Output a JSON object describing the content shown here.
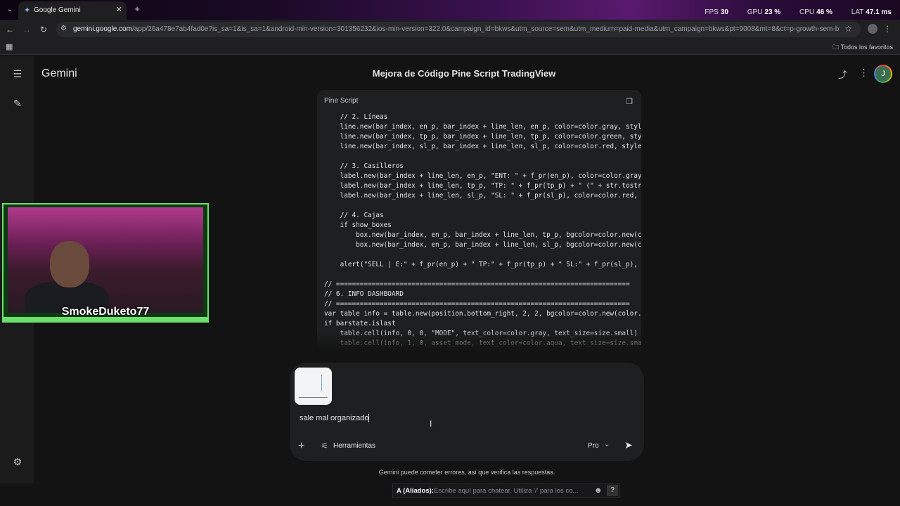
{
  "browser": {
    "tab_title": "Google Gemini",
    "tab_close": "✕",
    "new_tab": "+",
    "url_host": "gemini.google.com",
    "url_path": "/app/26a478e7ab4fad0e?is_sa=1&is_sa=1&android-min-version=301356232&ios-min-version=322.0&campaign_id=bkws&utm_source=sem&utm_medium=paid-media&utm_campaign=bkws&pt=9008&mt=8&ct=p-growth-sem-bkws&gclsrc...",
    "bookmarks_label": "Todos los favoritos"
  },
  "perf": {
    "fps_label": "FPS",
    "fps_value": "30",
    "gpu_label": "GPU",
    "gpu_value": "23 %",
    "cpu_label": "CPU",
    "cpu_value": "46 %",
    "lat_label": "LAT",
    "lat_value": "47.1 ms"
  },
  "app": {
    "brand": "Gemini",
    "chat_title": "Mejora de Código Pine Script TradingView",
    "avatar_initial": "J"
  },
  "code": {
    "language": "Pine Script",
    "lines": [
      "    // 2. Líneas",
      "    line.new(bar_index, en_p, bar_index + line_len, en_p, color=color.gray, style",
      "    line.new(bar_index, tp_p, bar_index + line_len, tp_p, color=color.green, styl",
      "    line.new(bar_index, sl_p, bar_index + line_len, sl_p, color=color.red, style=",
      "",
      "    // 3. Casilleros",
      "    label.new(bar_index + line_len, en_p, \"ENT: \" + f_pr(en_p), color=color.gray,",
      "    label.new(bar_index + line_len, tp_p, \"TP: \" + f_pr(tp_p) + \" (\" + str.tostri",
      "    label.new(bar_index + line_len, sl_p, \"SL: \" + f_pr(sl_p), color=color.red, s",
      "",
      "    // 4. Cajas",
      "    if show_boxes",
      "        box.new(bar_index, en_p, bar_index + line_len, tp_p, bgcolor=color.new(co",
      "        box.new(bar_index, en_p, bar_index + line_len, sl_p, bgcolor=color.new(co",
      "",
      "    alert(\"SELL | E:\" + f_pr(en_p) + \" TP:\" + f_pr(tp_p) + \" SL:\" + f_pr(sl_p), a",
      "",
      "// ==========================================================================",
      "// 6. INFO DASHBOARD",
      "// ==========================================================================",
      "var table info = table.new(position.bottom_right, 2, 2, bgcolor=color.new(color.b",
      "if barstate.islast",
      "    table.cell(info, 0, 0, \"MODE\", text_color=color.gray, text_size=size.small)",
      "    table.cell(info, 1, 0, asset_mode, text_color=color.aqua, text_size=size.smal"
    ]
  },
  "webcam": {
    "streamer_name": "SmokeDuketo77"
  },
  "composer": {
    "prompt_text": "sale mal organizado",
    "tools_label": "Herramientas",
    "mode_label": "Pro"
  },
  "disclaimer": "Gemini puede cometer errores, así que verifica las respuestas.",
  "stream_chat": {
    "prefix": "A (Aliados):",
    "placeholder": "Escribe aquí para chatear. Utiliza '/' para los co..."
  }
}
